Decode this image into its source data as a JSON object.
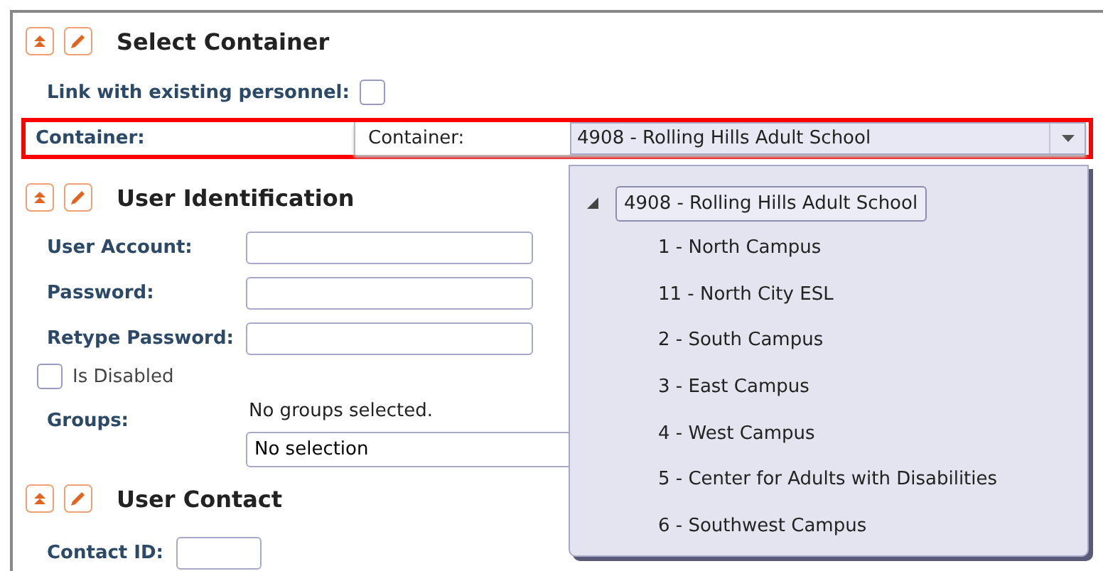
{
  "sections": [
    {
      "title": "Select Container",
      "fields": [
        {
          "kind": "checkbox",
          "label": "Link with existing personnel:",
          "checked": false
        },
        {
          "kind": "combo",
          "label": "Container:",
          "inner_label": "Container:",
          "value": "4908 - Rolling Hills Adult School",
          "highlighted": true
        }
      ]
    },
    {
      "title": "User Identification",
      "fields": [
        {
          "kind": "text",
          "label": "User Account:"
        },
        {
          "kind": "text",
          "label": "Password:"
        },
        {
          "kind": "text",
          "label": "Retype Password:"
        },
        {
          "kind": "check",
          "label": "Is Disabled",
          "checked": false
        },
        {
          "kind": "groups",
          "label": "Groups:",
          "note": "No groups selected.",
          "value": "No selection"
        }
      ]
    },
    {
      "title": "User Contact",
      "fields": [
        {
          "kind": "short",
          "label": "Contact ID:"
        }
      ]
    }
  ],
  "dropdown": {
    "tree": [
      {
        "label": "4908 - Rolling Hills Adult School",
        "selected": true,
        "expanded": true,
        "children": [
          {
            "label": "1 - North Campus",
            "selected": false
          },
          {
            "label": "11 - North City ESL",
            "selected": false
          },
          {
            "label": "2 - South Campus",
            "selected": false
          },
          {
            "label": "3 - East Campus",
            "selected": false
          },
          {
            "label": "4 - West Campus",
            "selected": false
          },
          {
            "label": "5 - Center for Adults with Disabilities",
            "selected": false
          },
          {
            "label": "6 - Southwest Campus",
            "selected": false
          }
        ]
      }
    ]
  }
}
